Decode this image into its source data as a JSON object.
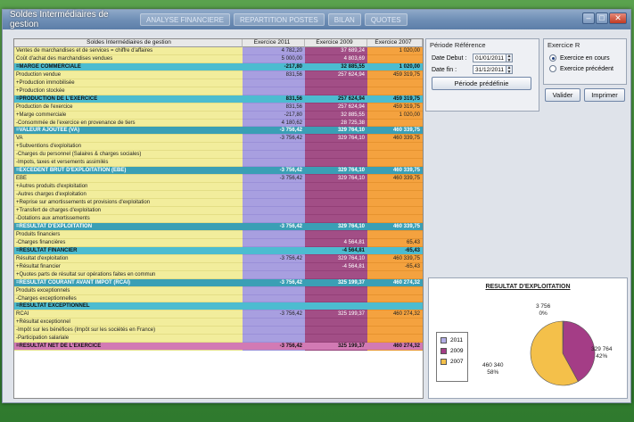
{
  "window": {
    "title": "Soldes Intermédiaires de gestion",
    "tabs": [
      "ANALYSE FINANCIERE",
      "REPARTITION POSTES",
      "BILAN",
      "QUOTES"
    ]
  },
  "grid": {
    "headers": [
      "Soldes Intermédiaires de gestion",
      "Exercice 2011",
      "Exercice 2009",
      "Exercice 2007"
    ],
    "rows": [
      {
        "label": "Ventes de marchandises et de services = chiffre d'affaires",
        "v2011": "4 782,20",
        "v2009": "37 689,24",
        "v2007": "1 020,00",
        "t": ""
      },
      {
        "label": "Coût d'achat des marchandises vendues",
        "v2011": "5 000,00",
        "v2009": "4 803,69",
        "v2007": "",
        "t": ""
      },
      {
        "label": "=MARGE COMMERCIALE",
        "v2011": "-217,80",
        "v2009": "32 885,55",
        "v2007": "1 020,00",
        "t": "t1"
      },
      {
        "label": "Production vendue",
        "v2011": "831,56",
        "v2009": "257 624,94",
        "v2007": "459 319,75",
        "t": ""
      },
      {
        "label": "+Production immobilisée",
        "v2011": "",
        "v2009": "",
        "v2007": "",
        "t": ""
      },
      {
        "label": "+Production stockée",
        "v2011": "",
        "v2009": "",
        "v2007": "",
        "t": ""
      },
      {
        "label": "=PRODUCTION DE L'EXERCICE",
        "v2011": "831,56",
        "v2009": "257 624,94",
        "v2007": "459 319,75",
        "t": "t1"
      },
      {
        "label": "Production de l'exercice",
        "v2011": "831,56",
        "v2009": "257 624,94",
        "v2007": "459 319,75",
        "t": ""
      },
      {
        "label": "+Marge commerciale",
        "v2011": "-217,80",
        "v2009": "32 885,55",
        "v2007": "1 020,00",
        "t": ""
      },
      {
        "label": "-Consommée de l'exercice en provenance de tiers",
        "v2011": "4 180,62",
        "v2009": "28 725,38",
        "v2007": "",
        "t": ""
      },
      {
        "label": "=VALEUR AJOUTEE (VA)",
        "v2011": "-3 756,42",
        "v2009": "329 764,10",
        "v2007": "460 339,75",
        "t": "t2"
      },
      {
        "label": "VA",
        "v2011": "-3 756,42",
        "v2009": "329 764,10",
        "v2007": "460 339,75",
        "t": ""
      },
      {
        "label": "+Subventions d'exploitation",
        "v2011": "",
        "v2009": "",
        "v2007": "",
        "t": ""
      },
      {
        "label": "-Charges du personnel (Salaires & charges sociales)",
        "v2011": "",
        "v2009": "",
        "v2007": "",
        "t": ""
      },
      {
        "label": "-Impots, taxes et versements assimilés",
        "v2011": "",
        "v2009": "",
        "v2007": "",
        "t": ""
      },
      {
        "label": "=EXCEDENT BRUT D'EXPLOITATION (EBE)",
        "v2011": "-3 756,42",
        "v2009": "329 764,10",
        "v2007": "460 339,75",
        "t": "t2"
      },
      {
        "label": "EBE",
        "v2011": "-3 756,42",
        "v2009": "329 764,10",
        "v2007": "460 339,75",
        "t": ""
      },
      {
        "label": "+Autres produits d'exploitation",
        "v2011": "",
        "v2009": "",
        "v2007": "",
        "t": ""
      },
      {
        "label": "-Autres charges d'exploitation",
        "v2011": "",
        "v2009": "",
        "v2007": "",
        "t": ""
      },
      {
        "label": "+Reprise sur amortissements et provisions d'exploitation",
        "v2011": "",
        "v2009": "",
        "v2007": "",
        "t": ""
      },
      {
        "label": "+Transfert de charges d'exploitation",
        "v2011": "",
        "v2009": "",
        "v2007": "",
        "t": ""
      },
      {
        "label": "-Dotations aux amortissements",
        "v2011": "",
        "v2009": "",
        "v2007": "",
        "t": ""
      },
      {
        "label": "=RESULTAT D'EXPLOITATION",
        "v2011": "-3 756,42",
        "v2009": "329 764,10",
        "v2007": "460 339,75",
        "t": "t2"
      },
      {
        "label": "Produits financiers",
        "v2011": "",
        "v2009": "",
        "v2007": "",
        "t": ""
      },
      {
        "label": "-Charges financières",
        "v2011": "",
        "v2009": "4 564,81",
        "v2007": "65,43",
        "t": ""
      },
      {
        "label": "=RESULTAT FINANCIER",
        "v2011": "",
        "v2009": "-4 564,81",
        "v2007": "-65,43",
        "t": "t1"
      },
      {
        "label": "Résultat d'exploitation",
        "v2011": "-3 756,42",
        "v2009": "329 764,10",
        "v2007": "460 339,75",
        "t": ""
      },
      {
        "label": "+Résultat financier",
        "v2011": "",
        "v2009": "-4 564,81",
        "v2007": "-65,43",
        "t": ""
      },
      {
        "label": "+Quotes parts de résultat sur opérations faites en commun",
        "v2011": "",
        "v2009": "",
        "v2007": "",
        "t": ""
      },
      {
        "label": "=RESULTAT COURANT AVANT IMPOT (RCAI)",
        "v2011": "-3 756,42",
        "v2009": "325 199,37",
        "v2007": "460 274,32",
        "t": "t2"
      },
      {
        "label": "Produits exceptionnels",
        "v2011": "",
        "v2009": "",
        "v2007": "",
        "t": ""
      },
      {
        "label": "-Charges exceptionnelles",
        "v2011": "",
        "v2009": "",
        "v2007": "",
        "t": ""
      },
      {
        "label": "=RESULTAT EXCEPTIONNEL",
        "v2011": "",
        "v2009": "",
        "v2007": "",
        "t": "t1"
      },
      {
        "label": "RCAI",
        "v2011": "-3 756,42",
        "v2009": "325 199,37",
        "v2007": "460 274,32",
        "t": ""
      },
      {
        "label": "+Résultat exceptionnel",
        "v2011": "",
        "v2009": "",
        "v2007": "",
        "t": ""
      },
      {
        "label": "-Impôt sur les bénéfices (Impôt sur les sociétés en France)",
        "v2011": "",
        "v2009": "",
        "v2007": "",
        "t": ""
      },
      {
        "label": "-Participation salariale",
        "v2011": "",
        "v2009": "",
        "v2007": "",
        "t": ""
      },
      {
        "label": "=RESULTAT NET DE L'EXERCICE",
        "v2011": "-3 756,42",
        "v2009": "325 199,37",
        "v2007": "460 274,32",
        "t": "t3"
      }
    ]
  },
  "periode": {
    "title": "Période Référence",
    "date_debut_label": "Date Debut :",
    "date_debut": "01/01/2011",
    "date_fin_label": "Date fin :",
    "date_fin": "31/12/2011",
    "predefined_button": "Période prédéfinie"
  },
  "exercice": {
    "title": "Exercice R",
    "option_current": "Exercice en cours",
    "option_previous": "Exercice précédent",
    "selected": "current"
  },
  "actions": {
    "validate": "Valider",
    "print": "Imprimer"
  },
  "chart_data": {
    "type": "pie",
    "title": "RESULTAT D'EXPLOITATION",
    "legend": [
      "2011",
      "2009",
      "2007"
    ],
    "legend_position": "left",
    "slices": [
      {
        "name": "2011",
        "value": 3756,
        "label": "3 756",
        "percent": "0%",
        "color": "#b3aee6"
      },
      {
        "name": "2009",
        "value": 329764,
        "label": "329 764",
        "percent": "42%",
        "color": "#a43d86"
      },
      {
        "name": "2007",
        "value": 460340,
        "label": "460 340",
        "percent": "58%",
        "color": "#f4c04a"
      }
    ]
  }
}
